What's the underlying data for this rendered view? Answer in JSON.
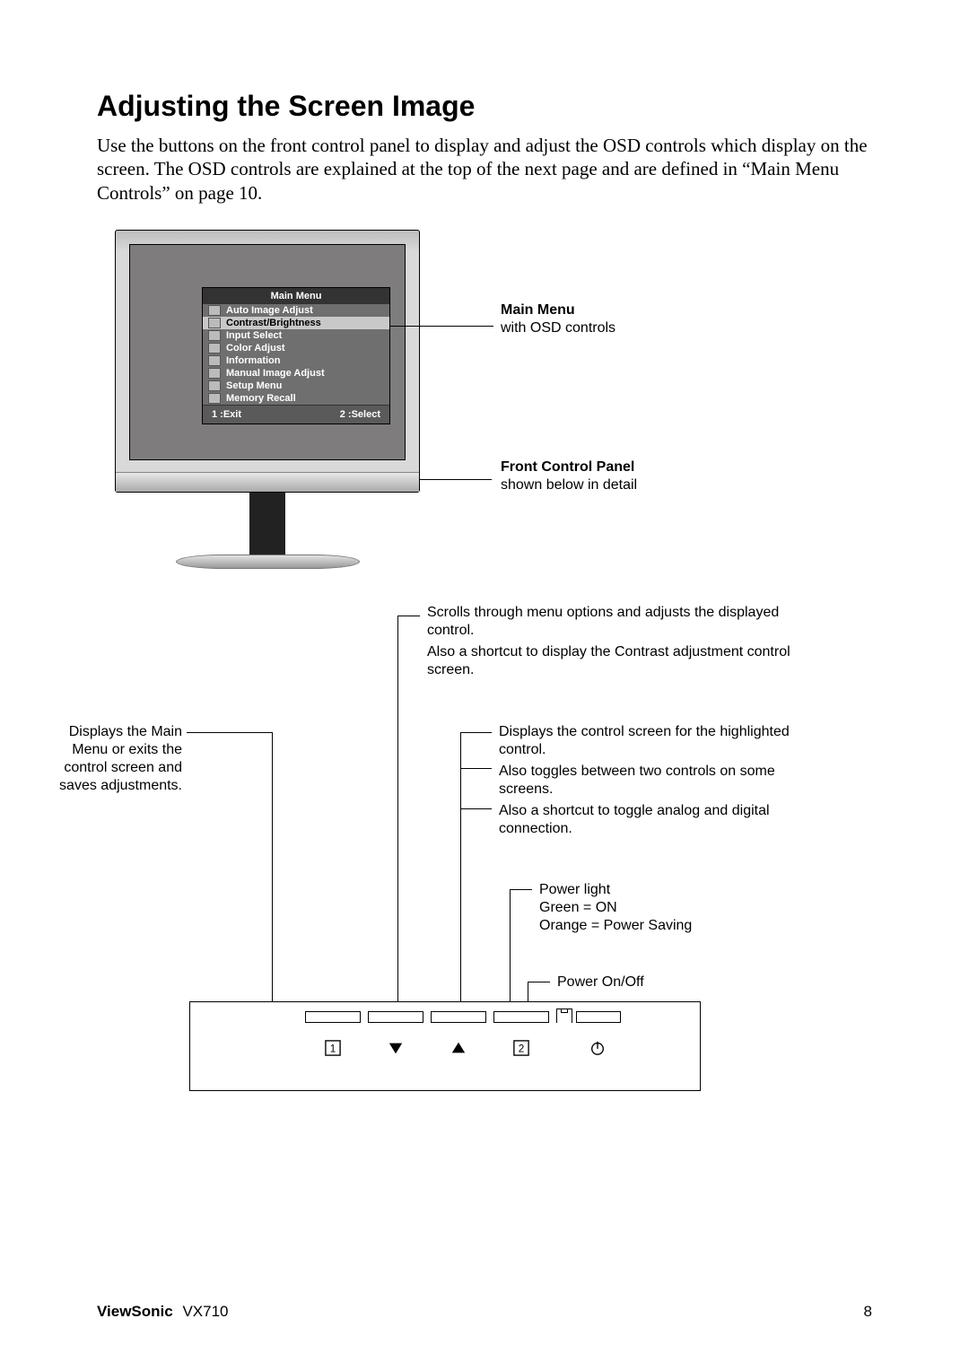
{
  "heading": "Adjusting the Screen Image",
  "intro": "Use the buttons on the front control panel to display and adjust the OSD controls which display on the screen. The OSD controls are explained at the top of the next page and are defined in “Main Menu Controls” on page 10.",
  "osd": {
    "title": "Main Menu",
    "items": [
      "Auto Image Adjust",
      "Contrast/Brightness",
      "Input Select",
      "Color Adjust",
      "Information",
      "Manual Image Adjust",
      "Setup Menu",
      "Memory Recall"
    ],
    "footer_left": "1 :Exit",
    "footer_right": "2 :Select"
  },
  "callouts": {
    "main_menu_title": "Main Menu",
    "main_menu_sub": "with OSD controls",
    "front_panel_title": "Front Control Panel",
    "front_panel_sub": "shown below in detail",
    "up_l1": "Scrolls through menu options and adjusts the displayed control.",
    "up_l2": "Also a shortcut to display the Contrast adjustment control screen.",
    "left": "Displays the Main Menu or exits the control screen and saves adjustments.",
    "right_l1": "Displays the control screen for the highlighted control.",
    "right_l2": "Also toggles between two controls on some screens.",
    "right_l3": "Also a shortcut to toggle analog and digital connection.",
    "power_light": "Power light",
    "green": "Green = ON",
    "orange": "Orange = Power Saving",
    "power_onoff": "Power On/Off"
  },
  "panel_icons": {
    "b1": "1",
    "b4": "2"
  },
  "footer": {
    "brand": "ViewSonic",
    "model": "VX710",
    "page": "8"
  }
}
